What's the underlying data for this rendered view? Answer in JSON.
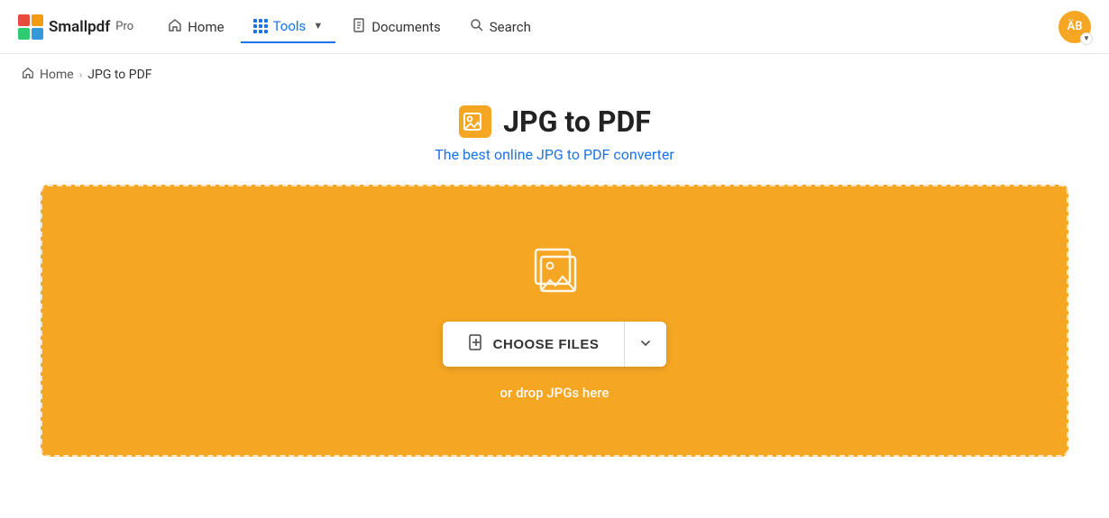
{
  "header": {
    "logo_name": "Smallpdf",
    "logo_pro": "Pro",
    "avatar_initials": "ÄB",
    "nav": {
      "home_label": "Home",
      "tools_label": "Tools",
      "documents_label": "Documents",
      "search_label": "Search"
    }
  },
  "breadcrumb": {
    "home_label": "Home",
    "separator": "›",
    "current_label": "JPG to PDF"
  },
  "main": {
    "page_title": "JPG to PDF",
    "page_subtitle": "The best online JPG to PDF converter",
    "choose_files_label": "CHOOSE FILES",
    "drop_hint": "or drop JPGs here"
  }
}
